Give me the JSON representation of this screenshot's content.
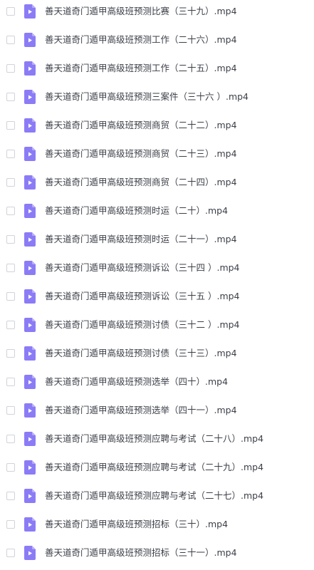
{
  "theme": {
    "icon_color": "#8b7cf6",
    "icon_fold_color": "#b9aefb",
    "text_color": "#3b3f47",
    "checkbox_border": "#cfd3da"
  },
  "files": [
    {
      "name": "善天道奇门遁甲高级班预测比赛（三十九）.mp4",
      "icon": "video-file-icon"
    },
    {
      "name": "善天道奇门遁甲高级班预测工作（二十六）.mp4",
      "icon": "video-file-icon"
    },
    {
      "name": "善天道奇门遁甲高级班预测工作（二十五）.mp4",
      "icon": "video-file-icon"
    },
    {
      "name": "善天道奇门遁甲高级班预测三案件（三十六 ）.mp4",
      "icon": "video-file-icon"
    },
    {
      "name": "善天道奇门遁甲高级班预测商贸（二十二）.mp4",
      "icon": "video-file-icon"
    },
    {
      "name": "善天道奇门遁甲高级班预测商贸（二十三）.mp4",
      "icon": "video-file-icon"
    },
    {
      "name": "善天道奇门遁甲高级班预测商贸（二十四）.mp4",
      "icon": "video-file-icon"
    },
    {
      "name": "善天道奇门遁甲高级班预测时运（二十）.mp4",
      "icon": "video-file-icon"
    },
    {
      "name": "善天道奇门遁甲高级班预测时运（二十一）.mp4",
      "icon": "video-file-icon"
    },
    {
      "name": "善天道奇门遁甲高级班预测诉讼（三十四 ）.mp4",
      "icon": "video-file-icon"
    },
    {
      "name": "善天道奇门遁甲高级班预测诉讼（三十五 ）.mp4",
      "icon": "video-file-icon"
    },
    {
      "name": "善天道奇门遁甲高级班预测讨债（三十二 ）.mp4",
      "icon": "video-file-icon"
    },
    {
      "name": "善天道奇门遁甲高级班预测讨债（三十三）.mp4",
      "icon": "video-file-icon"
    },
    {
      "name": "善天道奇门遁甲高级班预测选举（四十）.mp4",
      "icon": "video-file-icon"
    },
    {
      "name": "善天道奇门遁甲高级班预测选举（四十一）.mp4",
      "icon": "video-file-icon"
    },
    {
      "name": "善天道奇门遁甲高级班预测应聘与考试（二十八）.mp4",
      "icon": "video-file-icon"
    },
    {
      "name": "善天道奇门遁甲高级班预测应聘与考试（二十九）.mp4",
      "icon": "video-file-icon"
    },
    {
      "name": "善天道奇门遁甲高级班预测应聘与考试（二十七）.mp4",
      "icon": "video-file-icon"
    },
    {
      "name": "善天道奇门遁甲高级班预测招标（三十）.mp4",
      "icon": "video-file-icon"
    },
    {
      "name": "善天道奇门遁甲高级班预测招标（三十一）.mp4",
      "icon": "video-file-icon"
    }
  ]
}
